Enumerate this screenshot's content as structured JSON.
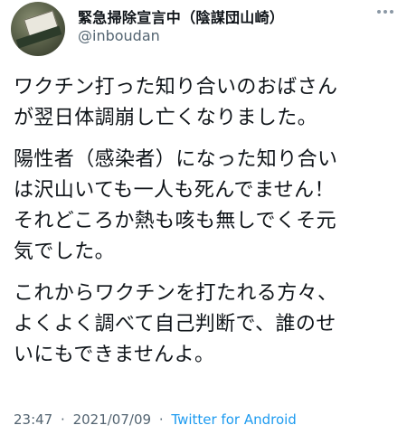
{
  "author": {
    "display_name": "緊急掃除宣言中（陰謀団山崎）",
    "handle": "@inboudan"
  },
  "tweet": {
    "paragraphs": [
      [
        "ワクチン打った知り合いのおばさん",
        "が翌日体調崩し亡くなりました。"
      ],
      [
        "陽性者（感染者）になった知り合い",
        "は沢山いても一人も死んでません！",
        "それどころか熱も咳も無しでくそ元",
        "気でした。"
      ],
      [
        "これからワクチンを打たれる方々、",
        "よくよく調べて自己判断で、誰のせ",
        "いにもできませんよ。"
      ]
    ]
  },
  "meta": {
    "time": "23:47",
    "date": "2021/07/09",
    "separator": "·",
    "source": "Twitter for Android"
  },
  "icons": {
    "avatar": "avatar-image",
    "more": "more-options-icon"
  },
  "colors": {
    "text": "#0f1419",
    "secondary": "#536471",
    "link": "#1d9bf0"
  }
}
